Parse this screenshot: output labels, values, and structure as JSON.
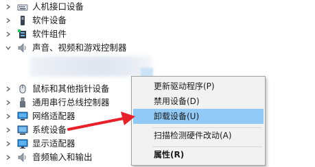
{
  "tree": {
    "items": [
      {
        "label": "人机接口设备",
        "icon": "hid-icon",
        "expanded": false
      },
      {
        "label": "软件设备",
        "icon": "software-device-icon",
        "expanded": false
      },
      {
        "label": "软件组件",
        "icon": "software-component-icon",
        "expanded": false
      },
      {
        "label": "声音、视频和游戏控制器",
        "icon": "speaker-icon",
        "expanded": true
      },
      {
        "label": "鼠标和其他指针设备",
        "icon": "mouse-icon",
        "expanded": false
      },
      {
        "label": "通用串行总线控制器",
        "icon": "usb-icon",
        "expanded": false
      },
      {
        "label": "网络适配器",
        "icon": "network-adapter-icon",
        "expanded": false
      },
      {
        "label": "系统设备",
        "icon": "system-device-icon",
        "expanded": false
      },
      {
        "label": "显示适配器",
        "icon": "display-adapter-icon",
        "expanded": false
      },
      {
        "label": "音频输入和输出",
        "icon": "audio-io-icon",
        "expanded": false
      }
    ]
  },
  "context_menu": {
    "update_driver": "更新驱动程序(P)",
    "disable_device": "禁用设备(D)",
    "uninstall_device": "卸载设备(U)",
    "scan_hardware": "扫描检测硬件改动(A)",
    "properties": "属性(R)"
  },
  "colors": {
    "menu_highlight": "#91c9f7",
    "arrow": "#e8202a"
  }
}
